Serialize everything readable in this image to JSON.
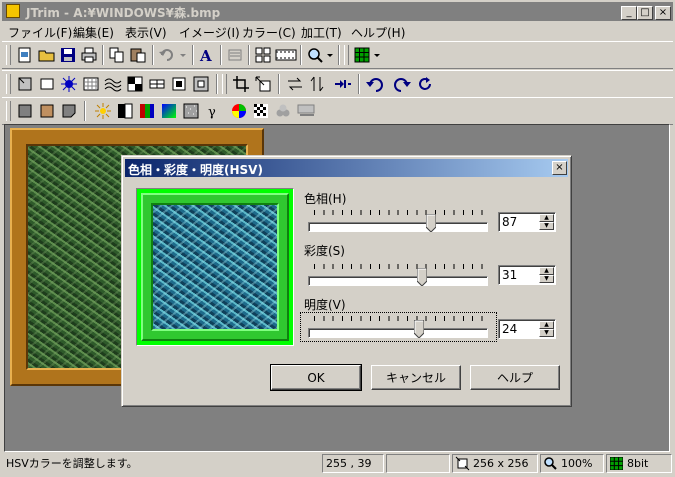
{
  "window": {
    "title": "JTrim - A:¥WINDOWS¥森.bmp",
    "minimize_glyph": "_",
    "maximize_glyph": "□",
    "close_glyph": "×"
  },
  "menu": [
    "ファイル(F)",
    "編集(E)",
    "表示(V)",
    "イメージ(I)",
    "カラー(C)",
    "加工(T)",
    "ヘルプ(H)"
  ],
  "toolbar": {
    "text_tool_label": "A",
    "icon_colors": {
      "accent": "#000080",
      "green": "#00a000",
      "red": "#c00000"
    }
  },
  "dialog": {
    "title": "色相・彩度・明度(HSV)",
    "close_glyph": "×",
    "sliders": [
      {
        "label": "色相(H)",
        "value": "87",
        "level": 0.69
      },
      {
        "label": "彩度(S)",
        "value": "31",
        "level": 0.64
      },
      {
        "label": "明度(V)",
        "value": "24",
        "level": 0.62
      }
    ],
    "buttons": {
      "ok": "OK",
      "cancel": "キャンセル",
      "help": "ヘルプ"
    }
  },
  "status": {
    "message": "HSVカラーを調整します。",
    "coords": "255 , 39",
    "size": "256 x 256",
    "zoom": "100%",
    "depth": "8bit"
  },
  "colors": {
    "preview_frame": "#00ff00",
    "image_frame": "#b0741c",
    "workspace": "#808080"
  }
}
